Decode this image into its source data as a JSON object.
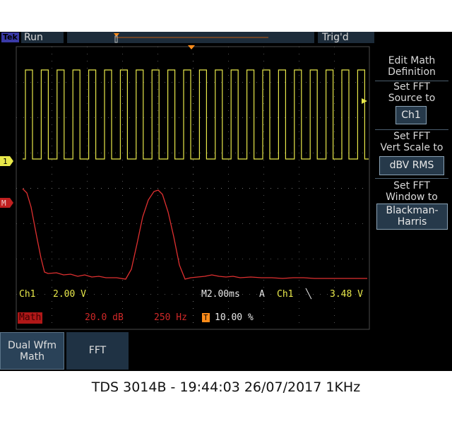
{
  "status": {
    "brand": "Tek",
    "state": "Run",
    "trigger_status": "Trig'd"
  },
  "channels": {
    "ch1_marker": "1",
    "math_marker": "M"
  },
  "readouts": {
    "ch1_label": "Ch1",
    "ch1_scale": "2.00 V",
    "timebase": "M2.00ms",
    "trigger_mode": "A",
    "trigger_source": "Ch1",
    "trigger_slope": "╲",
    "trigger_level": "3.48 V",
    "math_label": "Math",
    "math_scale": "20.0 dB",
    "math_freq": "250 Hz",
    "trigger_pos_icon": "T",
    "trigger_pos": "10.00 %"
  },
  "side_menu": {
    "item1_title_l1": "Edit Math",
    "item1_title_l2": "Definition",
    "item2_title_l1": "Set FFT",
    "item2_title_l2": "Source to",
    "item2_value": "Ch1",
    "item3_title_l1": "Set FFT",
    "item3_title_l2": "Vert Scale to",
    "item3_value": "dBV RMS",
    "item4_title_l1": "Set FFT",
    "item4_title_l2": "Window to",
    "item4_value_l1": "Blackman-",
    "item4_value_l2": "Harris"
  },
  "bottom_menu": {
    "dual_wfm_l1": "Dual Wfm",
    "dual_wfm_l2": "Math",
    "fft": "FFT"
  },
  "caption": "TDS 3014B - 19:44:03   26/07/2017 1KHz",
  "colors": {
    "ch1": "#e8e84a",
    "math": "#e03030",
    "grid": "#3c3c3c",
    "trigger_marker": "#ff8c1a"
  }
}
